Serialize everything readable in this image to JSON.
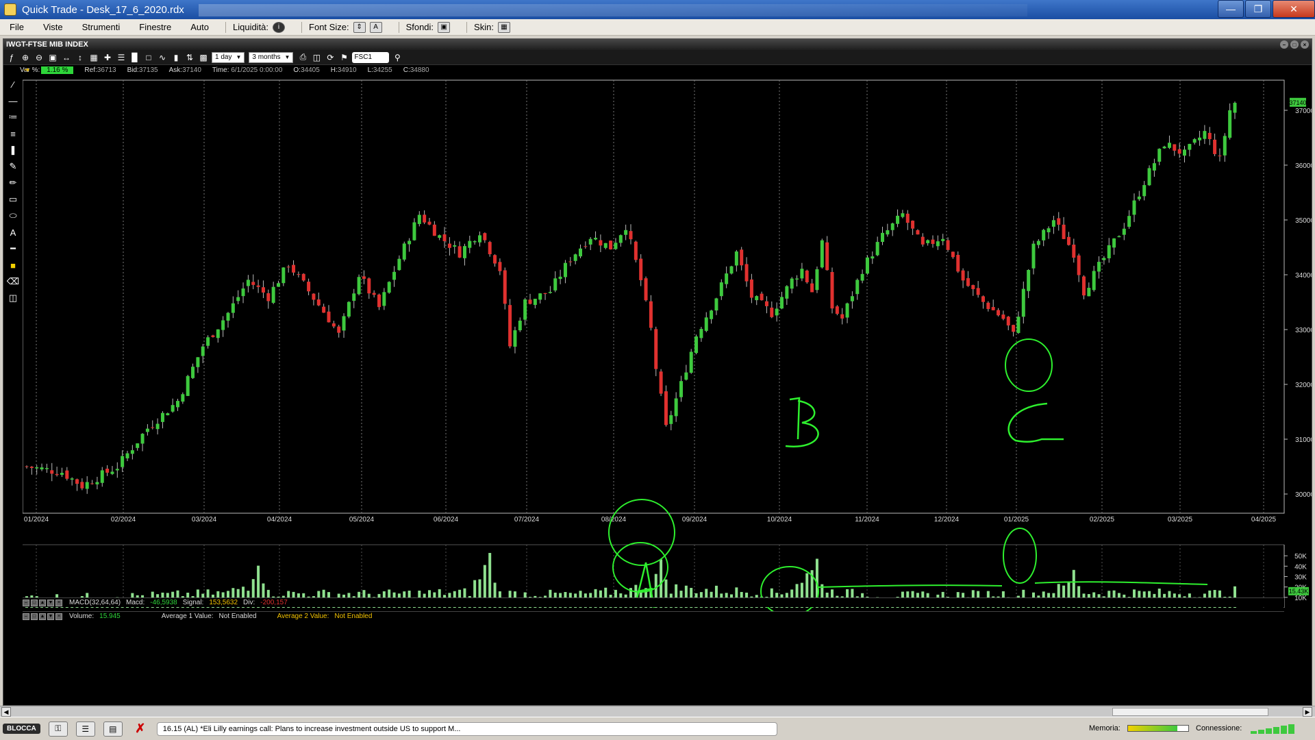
{
  "window": {
    "title": "Quick Trade - Desk_17_6_2020.rdx"
  },
  "menu": {
    "items": [
      "File",
      "Viste",
      "Strumenti",
      "Finestre",
      "Auto"
    ],
    "liquidita_label": "Liquidità:",
    "font_size_label": "Font Size:",
    "sfondi_label": "Sfondi:",
    "skin_label": "Skin:"
  },
  "chart_window": {
    "title": "IWGT-FTSE MIB INDEX",
    "toolbar": {
      "interval": "1 day",
      "range": "3 months",
      "symbol": "FSC1"
    },
    "quote": {
      "var_label": "Var %:",
      "var_value": "1.16 %",
      "ref_label": "Ref:",
      "ref_value": "36713",
      "bid_label": "Bid:",
      "bid_value": "37135",
      "ask_label": "Ask:",
      "ask_value": "37140",
      "time_label": "Time:",
      "time_value": "6/1/2025 0:00:00",
      "o_label": "O:",
      "o_value": "34405",
      "h_label": "H:",
      "h_value": "34910",
      "l_label": "L:",
      "l_value": "34255",
      "c_label": "C:",
      "c_value": "34880"
    },
    "last_price_badge": "37140",
    "macd": {
      "name": "MACD(32,64,64)",
      "macd_label": "Macd:",
      "macd_value": "-46,5938",
      "signal_label": "Signal:",
      "signal_value": "153,5632",
      "div_label": "Div:",
      "div_value": "-200,157"
    },
    "volume": {
      "label": "Volume:",
      "value": "15.945",
      "avg1_label": "Average 1 Value:",
      "avg1_value": "Not Enabled",
      "avg2_label": "Average 2 Value:",
      "avg2_value": "Not Enabled",
      "last_badge": "15.43K"
    },
    "annotations": [
      "A",
      "B",
      "C"
    ]
  },
  "chart_data": {
    "type": "candlestick",
    "title": "IWGT-FTSE MIB INDEX",
    "x_ticks": [
      "01/2024",
      "02/2024",
      "03/2024",
      "04/2024",
      "05/2024",
      "06/2024",
      "07/2024",
      "08/2024",
      "09/2024",
      "10/2024",
      "11/2024",
      "12/2024",
      "01/2025",
      "02/2025",
      "03/2025",
      "04/2025"
    ],
    "y_ticks": [
      30000,
      31000,
      32000,
      33000,
      34000,
      35000,
      36000,
      37000
    ],
    "ylim": [
      29650,
      37550
    ],
    "volume_ticks": [
      "50K",
      "40K",
      "30K",
      "20K",
      "10K"
    ],
    "volume_ylim": [
      0,
      58000
    ],
    "anchors": [
      [
        0,
        30500
      ],
      [
        7,
        30400
      ],
      [
        11,
        30150
      ],
      [
        18,
        30500
      ],
      [
        24,
        31200
      ],
      [
        30,
        31700
      ],
      [
        35,
        32700
      ],
      [
        40,
        33300
      ],
      [
        44,
        33900
      ],
      [
        48,
        33600
      ],
      [
        52,
        34200
      ],
      [
        56,
        33700
      ],
      [
        60,
        33200
      ],
      [
        62,
        32900
      ],
      [
        66,
        34000
      ],
      [
        70,
        33400
      ],
      [
        74,
        34300
      ],
      [
        78,
        35100
      ],
      [
        82,
        34700
      ],
      [
        86,
        34400
      ],
      [
        90,
        34800
      ],
      [
        94,
        34100
      ],
      [
        96,
        32700
      ],
      [
        99,
        33500
      ],
      [
        104,
        33700
      ],
      [
        108,
        34300
      ],
      [
        112,
        34700
      ],
      [
        116,
        34500
      ],
      [
        119,
        34900
      ],
      [
        122,
        33900
      ],
      [
        124,
        33000
      ],
      [
        125,
        32300
      ],
      [
        127,
        31200
      ],
      [
        130,
        32000
      ],
      [
        133,
        32900
      ],
      [
        137,
        33600
      ],
      [
        141,
        34400
      ],
      [
        144,
        33600
      ],
      [
        148,
        33300
      ],
      [
        152,
        33900
      ],
      [
        154,
        34100
      ],
      [
        156,
        33700
      ],
      [
        158,
        34600
      ],
      [
        160,
        33400
      ],
      [
        162,
        33200
      ],
      [
        166,
        34100
      ],
      [
        170,
        34700
      ],
      [
        174,
        35100
      ],
      [
        178,
        34500
      ],
      [
        182,
        34700
      ],
      [
        186,
        33900
      ],
      [
        190,
        33500
      ],
      [
        194,
        33200
      ],
      [
        196,
        32900
      ],
      [
        200,
        34500
      ],
      [
        204,
        35000
      ],
      [
        208,
        34400
      ],
      [
        210,
        33700
      ],
      [
        214,
        34300
      ],
      [
        218,
        34900
      ],
      [
        222,
        35700
      ],
      [
        226,
        36400
      ],
      [
        230,
        36200
      ],
      [
        234,
        36600
      ],
      [
        237,
        36100
      ],
      [
        239,
        37000
      ],
      [
        240,
        37140
      ]
    ],
    "volume_anchors": [
      [
        0,
        10500
      ],
      [
        20,
        11500
      ],
      [
        40,
        14500
      ],
      [
        44,
        22000
      ],
      [
        46,
        50000
      ],
      [
        48,
        14000
      ],
      [
        70,
        13500
      ],
      [
        88,
        15000
      ],
      [
        90,
        30000
      ],
      [
        92,
        46000
      ],
      [
        94,
        14000
      ],
      [
        110,
        13000
      ],
      [
        120,
        17000
      ],
      [
        124,
        23000
      ],
      [
        126,
        38000
      ],
      [
        128,
        19000
      ],
      [
        150,
        14000
      ],
      [
        156,
        34000
      ],
      [
        157,
        43000
      ],
      [
        159,
        16000
      ],
      [
        170,
        12000
      ],
      [
        200,
        14000
      ],
      [
        206,
        19000
      ],
      [
        208,
        32000
      ],
      [
        210,
        15000
      ],
      [
        238,
        14000
      ],
      [
        240,
        15945
      ]
    ]
  }
}
